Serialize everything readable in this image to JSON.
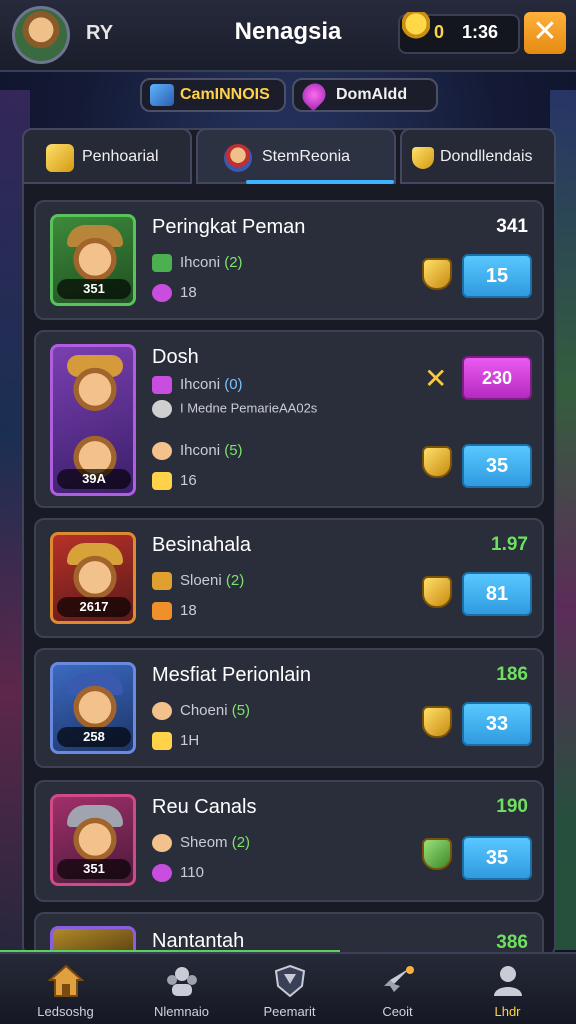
{
  "header": {
    "player_name": "RY",
    "title": "Nenagsia",
    "currency_value": "0",
    "timer": "1:36",
    "close_label": "✕"
  },
  "chips": [
    {
      "label": "CamINNOIS"
    },
    {
      "label": "DomAldd"
    }
  ],
  "tabs": [
    {
      "label": "Penhoarial"
    },
    {
      "label": "StemReonia"
    },
    {
      "label": "Dondllendais"
    }
  ],
  "rows": [
    {
      "name": "Peringkat Peman",
      "score": "341",
      "level": "351",
      "stat1_label": "Ihconi",
      "stat1_value": "(2)",
      "stat2_value": "18",
      "btn_value": "15"
    },
    {
      "name": "Dosh",
      "level": "39A",
      "stat_a_label": "Ihconi",
      "stat_a_value": "(0)",
      "sub_line": "I Medne PemarieAA02s",
      "pink_btn_value": "230",
      "stat1_label": "Ihconi",
      "stat1_value": "(5)",
      "stat2_value": "16",
      "btn_value": "35"
    },
    {
      "name": "Besinahala",
      "score": "1.97",
      "level": "2617",
      "stat1_label": "Sloeni",
      "stat1_value": "(2)",
      "stat2_value": "18",
      "btn_value": "81"
    },
    {
      "name": "Mesfiat Perionlain",
      "score": "186",
      "level": "258",
      "stat1_label": "Choeni",
      "stat1_value": "(5)",
      "stat2_value": "1H",
      "btn_value": "33"
    },
    {
      "name": "Reu Canals",
      "score": "190",
      "level": "351",
      "stat1_label": "Sheom",
      "stat1_value": "(2)",
      "stat2_value": "110",
      "btn_value": "35"
    },
    {
      "name": "Nantantah",
      "score": "386"
    }
  ],
  "nav": [
    {
      "label": "Ledsoshg"
    },
    {
      "label": "Nlemnaio"
    },
    {
      "label": "Peemarit"
    },
    {
      "label": "Ceoit"
    },
    {
      "label": "Lhdr"
    }
  ],
  "colors": {
    "accent_blue": "#3fb2ff",
    "gold": "#ffd24a",
    "green_score": "#6ee060",
    "pink_button": "#d33edc"
  }
}
